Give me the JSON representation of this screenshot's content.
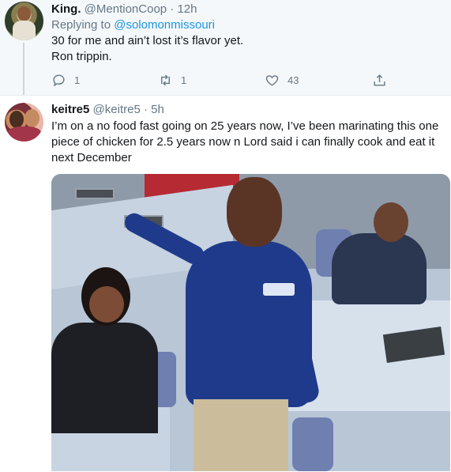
{
  "tweets": [
    {
      "name": "King.",
      "handle": "@MentionCoop",
      "separator": "·",
      "time": "12h",
      "replying_prefix": "Replying to",
      "replying_to": "@solomonmissouri",
      "lines": [
        "30 for me and ain’t lost it’s flavor yet.",
        "Ron trippin."
      ],
      "actions": {
        "reply_count": "1",
        "retweet_count": "1",
        "like_count": "43",
        "share_count": ""
      }
    },
    {
      "name": "keitre5",
      "handle": "@keitre5",
      "separator": "·",
      "time": "5h",
      "lines": [
        "I’m on a no food fast going on 25 years now, I’ve been marinating this one",
        "piece of chicken for 2.5 years now n Lord said i can finally cook and eat it",
        "next December"
      ]
    }
  ],
  "icons": {
    "reply": "reply-icon",
    "retweet": "retweet-icon",
    "like": "heart-icon",
    "share": "share-icon"
  },
  "colors": {
    "link": "#1b95e0",
    "secondary_text": "#657786",
    "primary_text": "#14171a",
    "thread_line": "#ccd6dd",
    "reply_background": "#f5f8fa"
  }
}
